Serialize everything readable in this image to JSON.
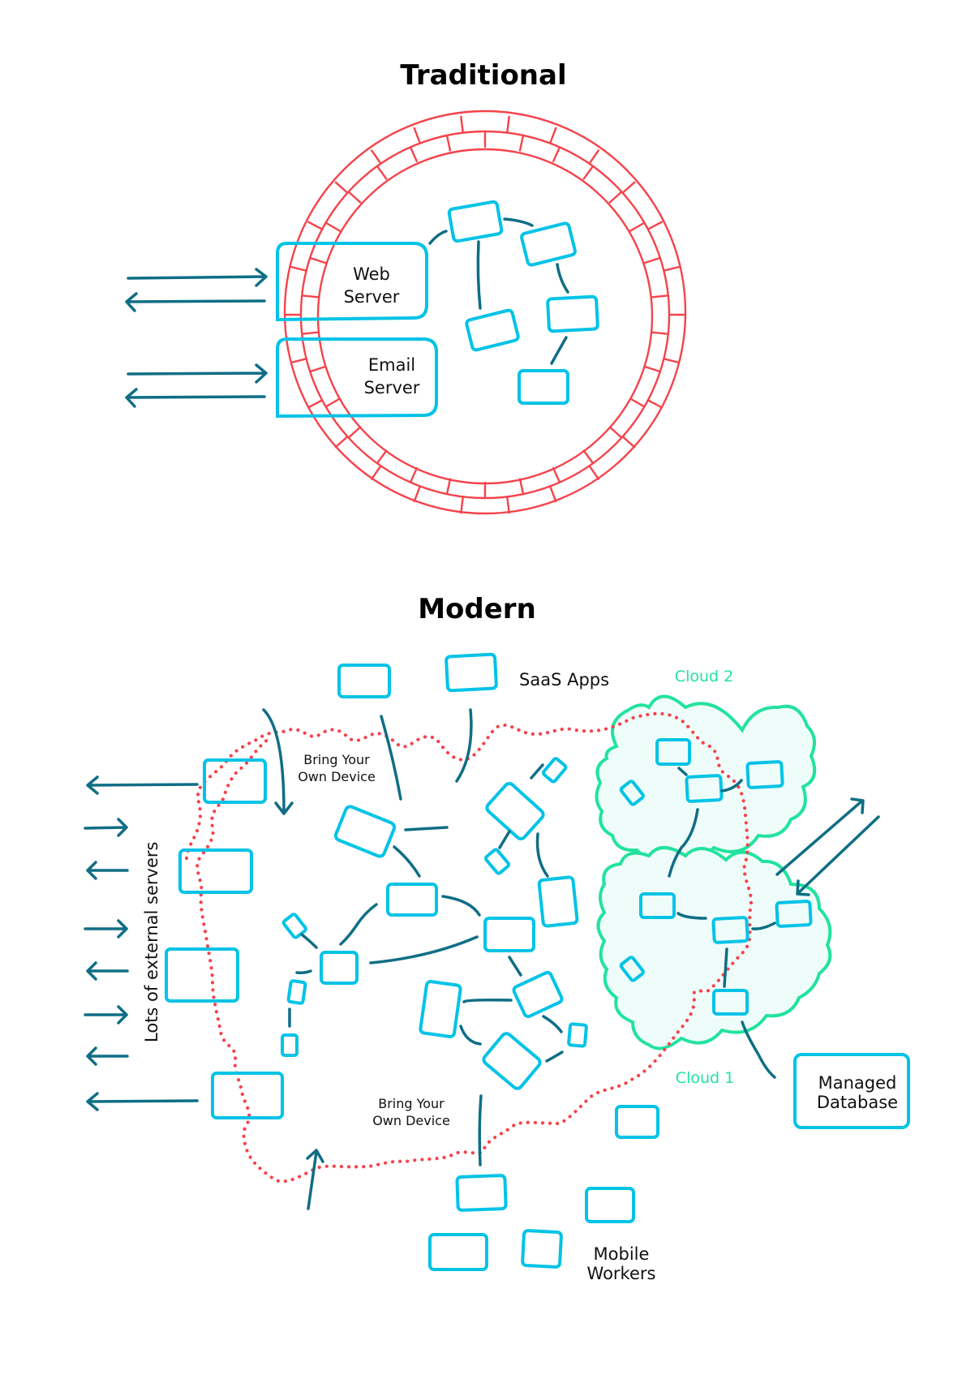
{
  "traditional": {
    "title": "Traditional",
    "web_server": [
      "Web",
      "Server"
    ],
    "email_server": [
      "Email",
      "Server"
    ]
  },
  "modern": {
    "title": "Modern",
    "saas_apps": "SaaS Apps",
    "cloud_2": "Cloud 2",
    "cloud_1": "Cloud 1",
    "byod_top": [
      "Bring Your",
      "Own Device"
    ],
    "byod_bottom": [
      "Bring Your",
      "Own Device"
    ],
    "external_servers": "Lots of external servers",
    "managed_database": [
      "Managed",
      "Database"
    ],
    "mobile_workers": [
      "Mobile",
      "Workers"
    ]
  },
  "colors": {
    "node": "#00c3e6",
    "link": "#0f6e85",
    "wall": "#f5434b",
    "cloud_stroke": "#22e39e",
    "cloud_fill": "#effdfa"
  }
}
